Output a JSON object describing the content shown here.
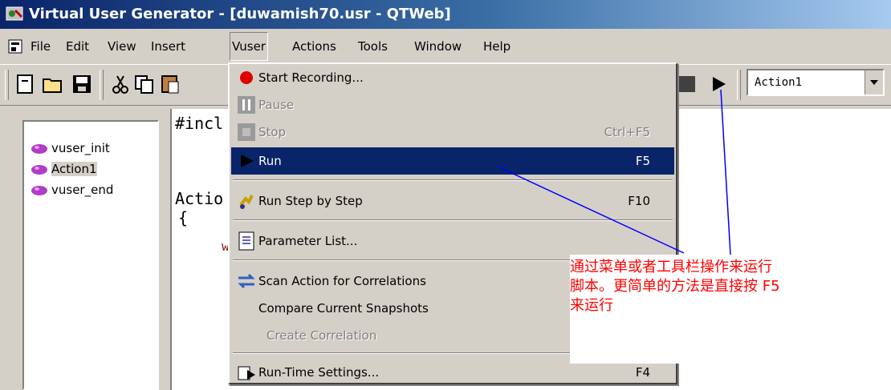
{
  "window": {
    "title": "Virtual User Generator - [duwamish70.usr - QTWeb]"
  },
  "menubar": {
    "items": [
      "File",
      "Edit",
      "View",
      "Insert",
      "Vuser",
      "Actions",
      "Tools",
      "Window",
      "Help"
    ]
  },
  "toolbar": {
    "action_select_value": "Action1"
  },
  "tree": {
    "items": [
      "vuser_init",
      "Action1",
      "vuser_end"
    ],
    "selected": "Action1"
  },
  "editor": {
    "line1": "#incl",
    "line2": "Actio",
    "line3": "{",
    "line4": "w"
  },
  "vuser_menu": {
    "items": [
      {
        "label": "Start Recording...",
        "shortcut": "",
        "icon": "record-icon",
        "disabled": false
      },
      {
        "label": "Pause",
        "shortcut": "",
        "icon": "pause-icon",
        "disabled": true
      },
      {
        "label": "Stop",
        "shortcut": "Ctrl+F5",
        "icon": "stop-icon",
        "disabled": true
      },
      {
        "label": "Run",
        "shortcut": "F5",
        "icon": "run-icon",
        "disabled": false,
        "highlighted": true
      },
      {
        "label": "Run Step by Step",
        "shortcut": "F10",
        "icon": "step-icon",
        "disabled": false
      },
      {
        "label": "Parameter List...",
        "shortcut": "",
        "icon": "parameter-list-icon",
        "disabled": false
      },
      {
        "label": "Scan Action for Correlations",
        "shortcut": "",
        "icon": "scan-icon",
        "disabled": false
      },
      {
        "label": "Compare Current Snapshots",
        "shortcut": "",
        "icon": "",
        "disabled": false
      },
      {
        "label": "Create Correlation",
        "shortcut": "",
        "icon": "",
        "disabled": true
      },
      {
        "label": "Run-Time Settings...",
        "shortcut": "F4",
        "icon": "runtime-settings-icon",
        "disabled": false
      }
    ]
  },
  "annotation": {
    "line1": "通过菜单或者工具栏操作来运行",
    "line2": "脚本。更简单的方法是直接按 F5",
    "line3": "来运行",
    "color": "#ff0000"
  },
  "colors": {
    "highlight": "#0a246a",
    "face": "#d4d0c8",
    "annotation_line": "#0000ff"
  }
}
